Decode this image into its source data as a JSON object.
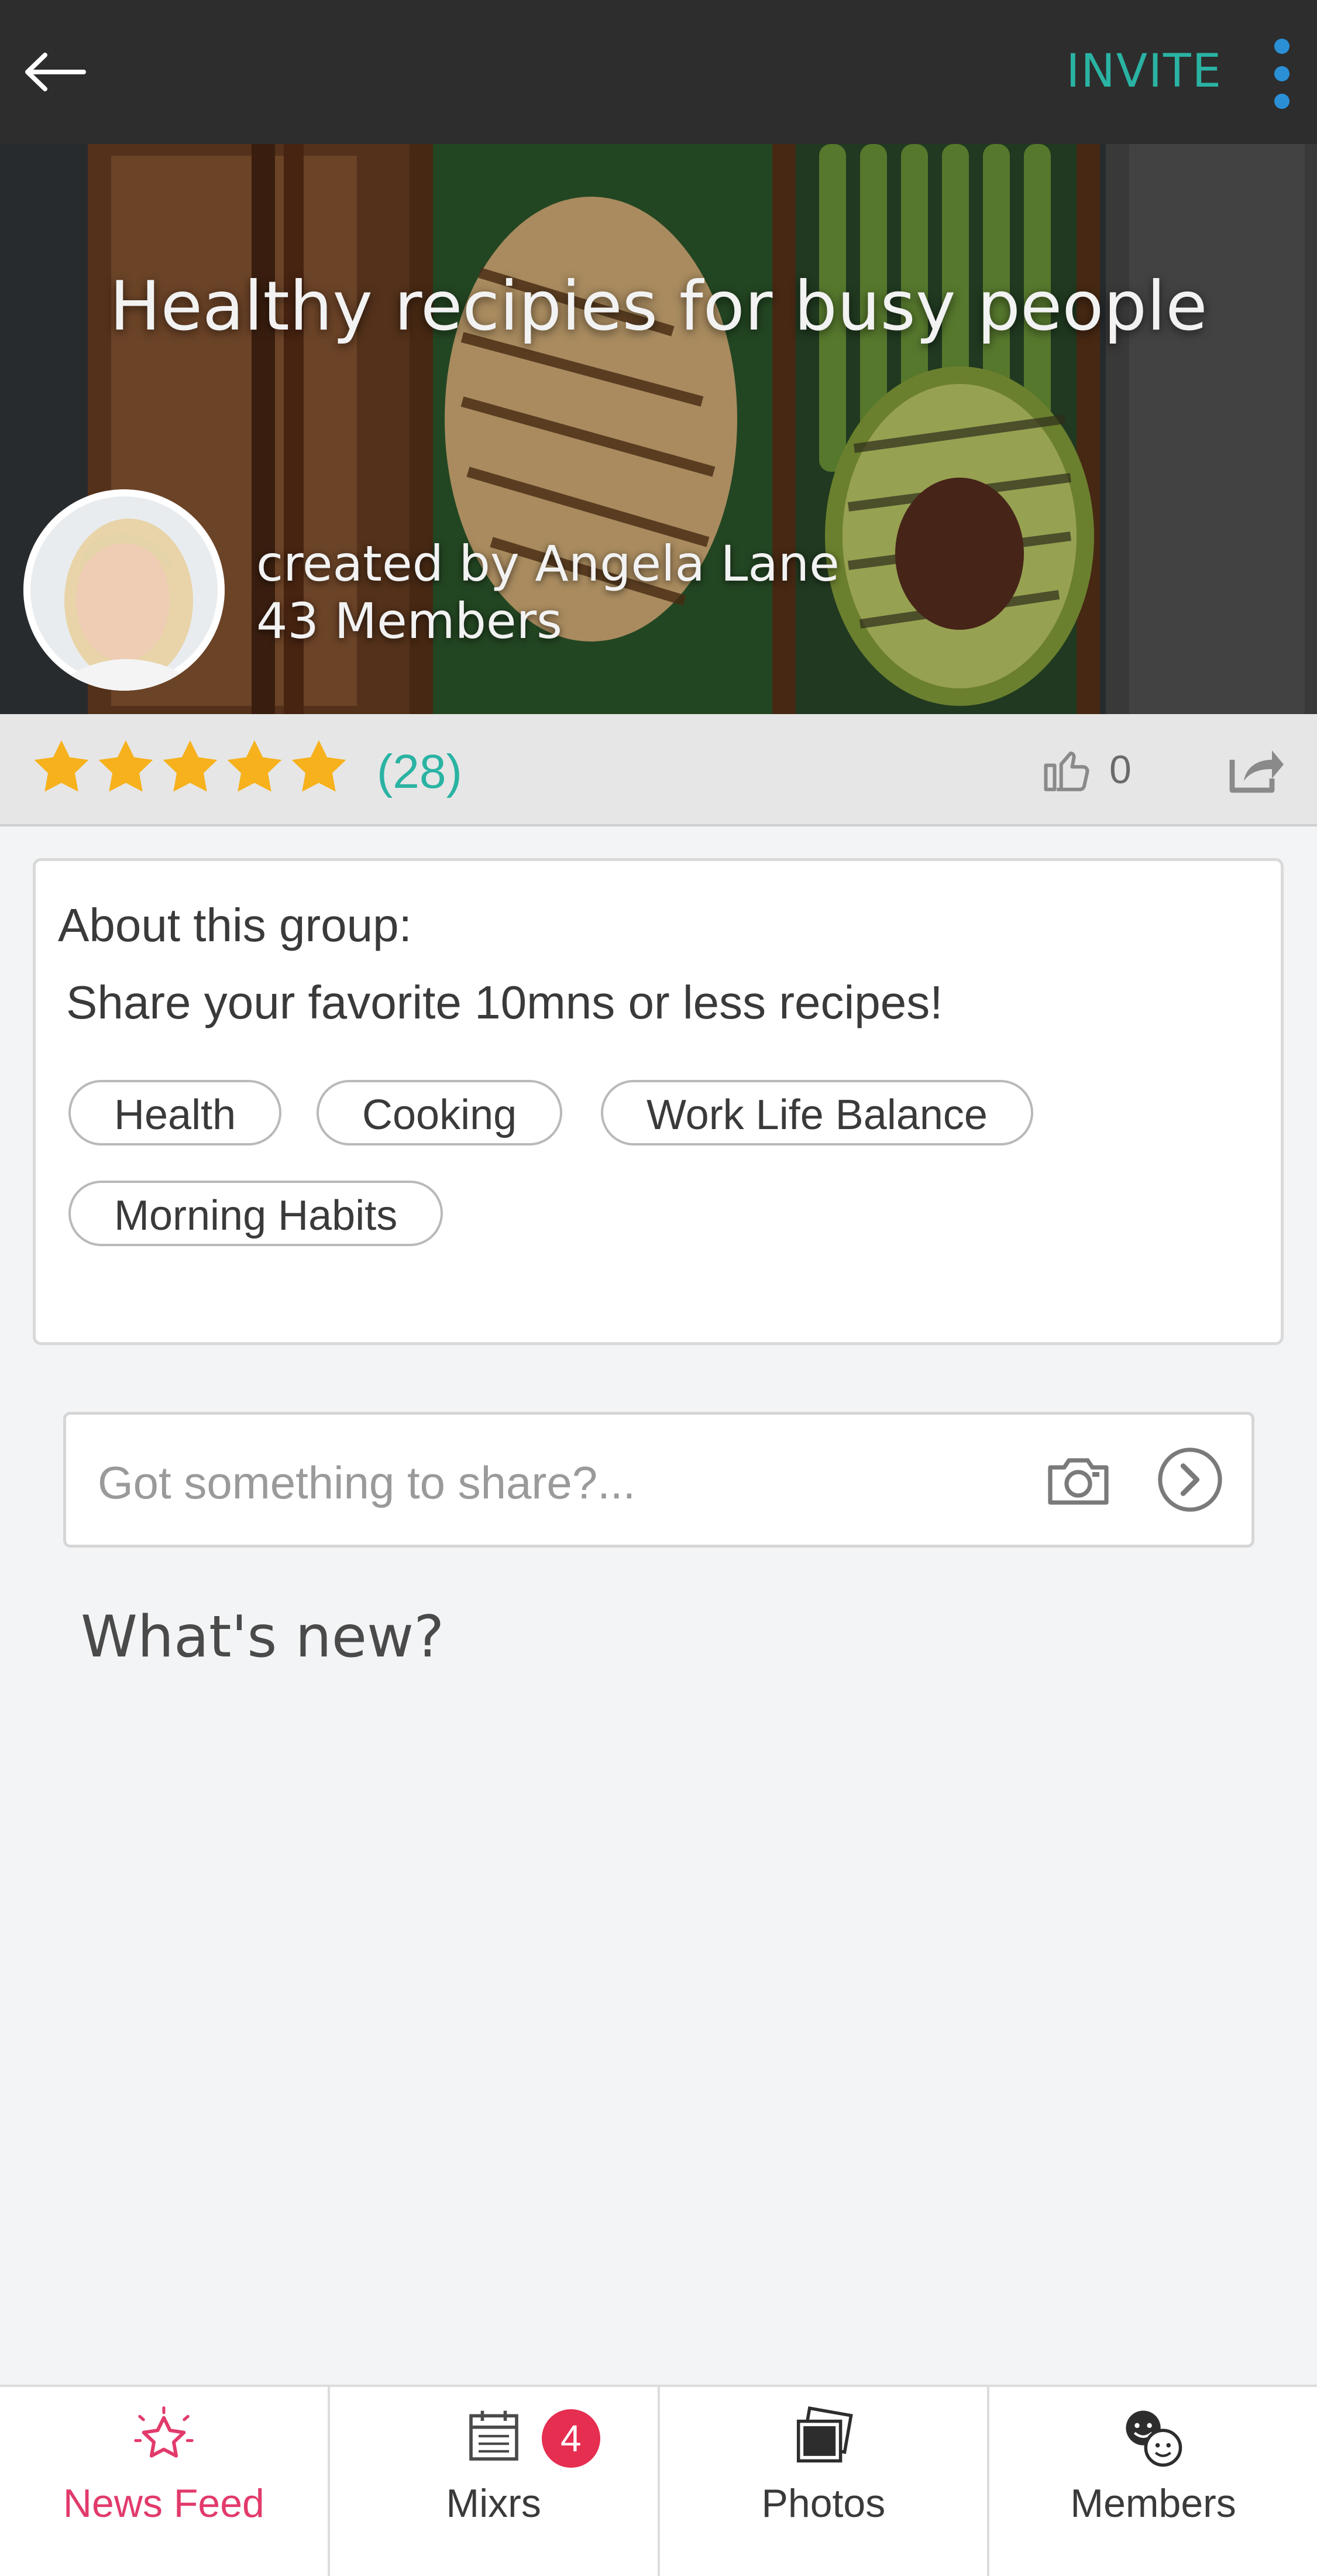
{
  "topbar": {
    "invite_label": "INVITE"
  },
  "hero": {
    "title": "Healthy recipies for busy people",
    "created_by": "created by Angela Lane",
    "members": "43 Members"
  },
  "rating": {
    "stars": 5,
    "count_label": "(28)",
    "likes": "0"
  },
  "about": {
    "heading": "About this group:",
    "description": "Share your favorite 10mns or less recipes!",
    "tags": [
      "Health",
      "Cooking",
      "Work Life Balance",
      "Morning Habits"
    ]
  },
  "composer": {
    "placeholder": "Got something to share?..."
  },
  "feed": {
    "heading": "What's new?"
  },
  "nav": {
    "items": [
      {
        "label": "News Feed",
        "icon": "star-icon",
        "active": true
      },
      {
        "label": "Mixrs",
        "icon": "calendar-icon",
        "badge": "4"
      },
      {
        "label": "Photos",
        "icon": "photos-icon"
      },
      {
        "label": "Members",
        "icon": "members-icon"
      }
    ]
  },
  "colors": {
    "accent_teal": "#2ab3a3",
    "active_pink": "#e23a6b",
    "badge_red": "#e52e50",
    "star_yellow": "#f6b11c",
    "topbar_dark": "#2d2d2d"
  }
}
